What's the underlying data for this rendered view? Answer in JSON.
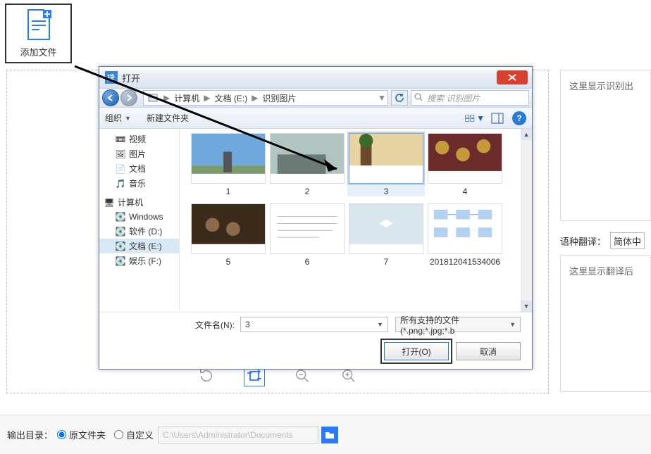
{
  "add_file_label": "添加文件",
  "drop_tools": {
    "icons": [
      "rotate-ccw-icon",
      "rotate-crop-icon",
      "zoom-out-icon",
      "zoom-in-icon"
    ]
  },
  "right_panel": {
    "ocr_placeholder": "这里显示识别出",
    "translate_label": "语种翻译：",
    "translate_lang": "简体中",
    "translate_result_placeholder": "这里显示翻译后"
  },
  "bottom": {
    "label": "输出目录：",
    "opt_original": "原文件夹",
    "opt_custom": "自定义",
    "selected": "original",
    "path_hint": "C:\\Users\\Administrator\\Documents"
  },
  "dialog": {
    "title": "打开",
    "crumbs": [
      "计算机",
      "文档 (E:)",
      "识别图片"
    ],
    "search_placeholder": "搜索 识别图片",
    "toolbar": {
      "organize": "组织",
      "new_folder": "新建文件夹"
    },
    "side_groups": {
      "libraries": [
        {
          "icon": "video-icon",
          "label": "视频"
        },
        {
          "icon": "picture-icon",
          "label": "图片"
        },
        {
          "icon": "document-icon",
          "label": "文档"
        },
        {
          "icon": "music-icon",
          "label": "音乐"
        }
      ],
      "computer_label": "计算机",
      "drives": [
        {
          "icon": "drive-icon",
          "label": "Windows"
        },
        {
          "icon": "drive-icon",
          "label": "软件 (D:)"
        },
        {
          "icon": "drive-icon",
          "label": "文档 (E:)",
          "selected": true
        },
        {
          "icon": "drive-icon",
          "label": "娱乐 (F:)"
        }
      ]
    },
    "files": [
      {
        "name": "1",
        "thumb": "landscape",
        "selected": false
      },
      {
        "name": "2",
        "thumb": "city",
        "selected": false
      },
      {
        "name": "3",
        "thumb": "tree",
        "selected": true
      },
      {
        "name": "4",
        "thumb": "coins",
        "selected": false
      },
      {
        "name": "5",
        "thumb": "crowd",
        "selected": false
      },
      {
        "name": "6",
        "thumb": "text",
        "selected": false
      },
      {
        "name": "7",
        "thumb": "bird",
        "selected": false
      },
      {
        "name": "201812041534006",
        "thumb": "diagram",
        "selected": false
      }
    ],
    "filename_label": "文件名(N):",
    "filename_value": "3",
    "filetype_value": "所有支持的文件(*.png;*.jpg;*.b",
    "open_btn": "打开(O)",
    "cancel_btn": "取消"
  }
}
